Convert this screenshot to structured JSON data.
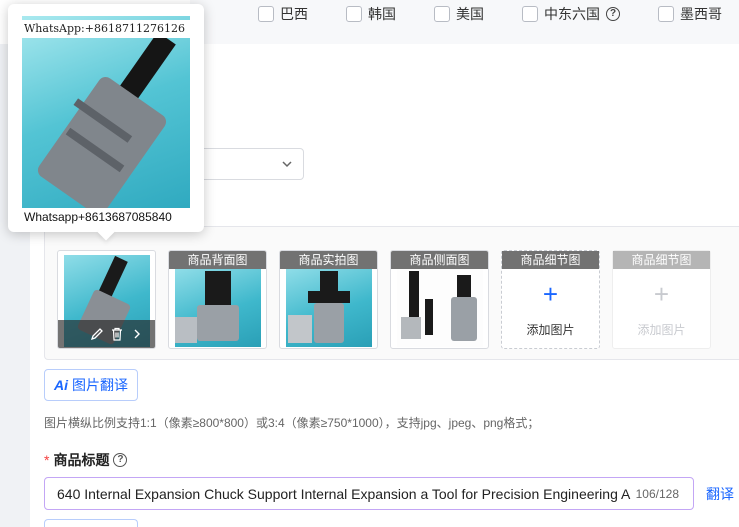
{
  "regions": [
    {
      "label": "墨西哥"
    },
    {
      "label": "韩国"
    },
    {
      "label": "巴西"
    },
    {
      "label": "韩国"
    },
    {
      "label": "美国"
    },
    {
      "label": "中东六国"
    },
    {
      "label": "墨西哥"
    }
  ],
  "popover": {
    "watermark_top": "WhatsApp:+8618711276126",
    "watermark_bottom": "Whatsapp+8613687085840"
  },
  "thumbnails": [
    {
      "label": "",
      "kind": "main"
    },
    {
      "label": "商品背面图"
    },
    {
      "label": "商品实拍图"
    },
    {
      "label": "商品侧面图"
    }
  ],
  "add_slots": [
    {
      "label": "商品细节图",
      "button": "添加图片"
    },
    {
      "label": "商品细节图",
      "button": "添加图片"
    }
  ],
  "image_translate": {
    "ai": "Ai",
    "label": "图片翻译"
  },
  "hint": "图片横纵比例支持1:1（像素≥800*800）或3:4（像素≥750*1000），支持jpg、jpeg、png格式；",
  "title_field": {
    "required_mark": "*",
    "label": "商品标题",
    "value": "640 Internal Expansion Chuck Support Internal Expansion a Tool for Precision Engineering A",
    "count": "106/128",
    "translate": "翻译"
  },
  "colors": {
    "accent": "#1a66ff",
    "required": "#f53f3f",
    "input_focus": "#c3a6f5"
  }
}
